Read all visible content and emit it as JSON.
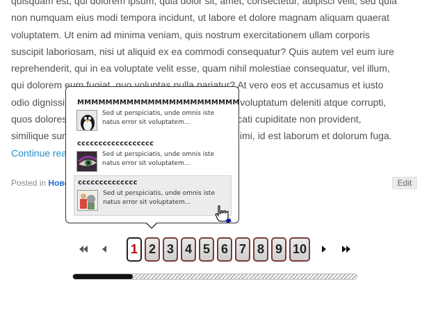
{
  "article": {
    "lines": [
      "quisquam est, qui dolorem ipsum, quia dolor sit, amet, consectetur, adipisci velit, sed quia",
      "non numquam eius modi tempora incidunt, ut labore et dolore magnam aliquam quaerat",
      "voluptatem. Ut enim ad minima veniam, quis nostrum exercitationem ullam corporis",
      "suscipit laboriosam, nisi ut aliquid ex ea commodi consequatur? Quis autem vel eum iure",
      "reprehenderit, qui in ea voluptate velit esse, quam nihil molestiae consequatur, vel illum,",
      "qui dolorem eum fugiat, quo voluptas nulla pariatur? At vero eos et accusamus et iusto",
      "odio dignissimos ducimus, qui blanditiis praesentium voluptatum deleniti atque corrupti,",
      "quos dolores et quas molestias excepturi sint, obcaecati cupiditate non provident,",
      "similique sunt in culpa, qui officia deserunt mollitia animi, id est laborum et dolorum fuga."
    ],
    "continue_link": "Continue reading →"
  },
  "meta": {
    "posted_label": "Posted in",
    "category": "Новости",
    "edit_label": "Edit"
  },
  "popup": {
    "entries": [
      {
        "title": "MMMMMMMMMMMMMMMMMMMMMMM",
        "desc": "Sed ut perspiciatis, unde omnis iste natus error sit voluptatem...",
        "thumb": "penguin-thumbnail"
      },
      {
        "title": "cccccccccccccccccc",
        "desc": "Sed ut perspiciatis, unde omnis iste natus error sit voluptatem...",
        "thumb": "eye-thumbnail"
      },
      {
        "title": "cccccccccccccc",
        "desc": "Sed ut perspiciatis, unde omnis iste natus error sit voluptatem...",
        "thumb": "cartoon-thumbnail"
      }
    ]
  },
  "pagination": {
    "pages": [
      "1",
      "2",
      "3",
      "4",
      "5",
      "6",
      "7",
      "8",
      "9",
      "10"
    ],
    "current": "1",
    "icons": {
      "first": "first-page-icon",
      "prev": "prev-page-icon",
      "next": "next-page-icon",
      "last": "last-page-icon"
    },
    "scroll_progress": 0.21
  }
}
